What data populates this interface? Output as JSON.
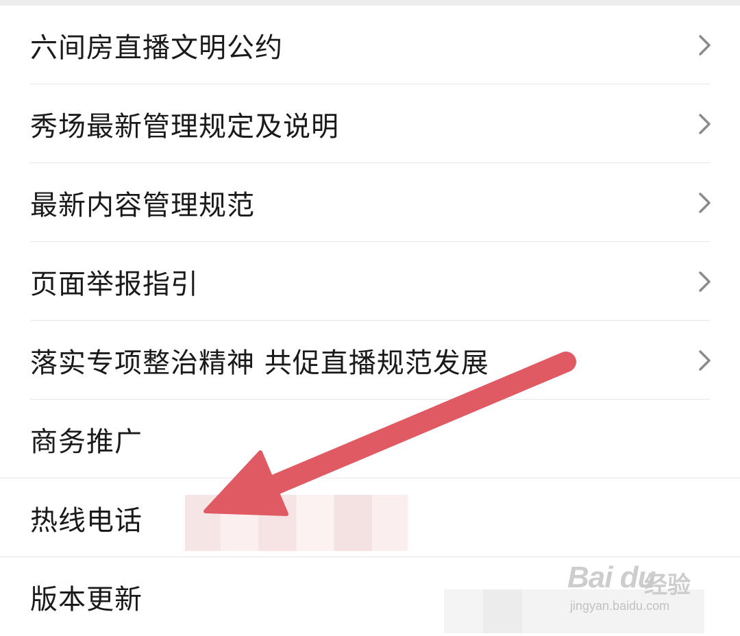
{
  "menu": {
    "items": [
      {
        "label": "六间房直播文明公约",
        "has_chevron": true
      },
      {
        "label": "秀场最新管理规定及说明",
        "has_chevron": true
      },
      {
        "label": "最新内容管理规范",
        "has_chevron": true
      },
      {
        "label": "页面举报指引",
        "has_chevron": true
      },
      {
        "label": "落实专项整治精神 共促直播规范发展",
        "has_chevron": true
      },
      {
        "label": "商务推广",
        "has_chevron": false
      },
      {
        "label": "热线电话",
        "has_chevron": false
      },
      {
        "label": "版本更新",
        "has_chevron": false
      }
    ]
  },
  "icons": {
    "chevron": "chevron-right-icon",
    "arrow": "red-annotation-arrow"
  },
  "colors": {
    "arrow": "#e05a64",
    "chevron": "#8a8a8a",
    "text": "#1a1a1a"
  },
  "watermark": {
    "logo": "Bai du",
    "text": "经验",
    "url": "jingyan.baidu.com"
  }
}
